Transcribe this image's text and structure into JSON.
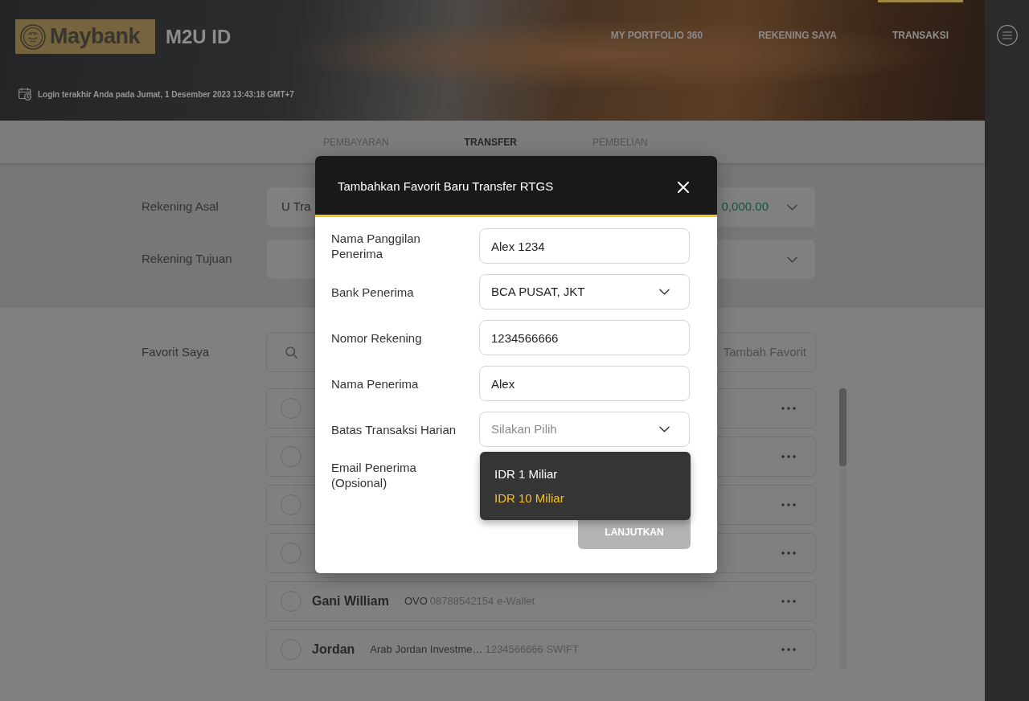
{
  "header": {
    "brand": "Maybank",
    "product": "M2U ID",
    "nav": [
      {
        "label": "MY PORTFOLIO 360",
        "selected": false
      },
      {
        "label": "REKENING SAYA",
        "selected": false
      },
      {
        "label": "TRANSAKSI",
        "selected": true
      }
    ],
    "last_login": "Login terakhir Anda pada Jumat, 1 Desember 2023 13:43:18 GMT+7"
  },
  "tabs": [
    {
      "label": "PEMBAYARAN",
      "selected": false
    },
    {
      "label": "TRANSFER",
      "selected": true
    },
    {
      "label": "PEMBELIAN",
      "selected": false
    }
  ],
  "transfer_form": {
    "rows": [
      {
        "label": "Rekening Asal",
        "value": "U Tra",
        "amount": "0,000.00"
      },
      {
        "label": "Rekening Tujuan"
      }
    ]
  },
  "favorites": {
    "label": "Favorit Saya",
    "add_button": "Tambah Favorit",
    "items": [
      {
        "selected": false
      },
      {
        "selected": false
      },
      {
        "selected": false
      },
      {
        "selected": false
      },
      {
        "selected": false,
        "name": "Gani William",
        "bank": "OVO",
        "detail": "08788542154 e-Wallet"
      },
      {
        "selected": false,
        "name": "Jordan",
        "bank": "Arab Jordan Investme…",
        "detail": "1234566666 SWIFT"
      }
    ]
  },
  "dialog": {
    "title": "Tambahkan Favorit Baru Transfer RTGS",
    "fields": [
      {
        "label": "Nama Panggilan Penerima",
        "kind": "text",
        "value": "Alex 1234"
      },
      {
        "label": "Bank Penerima",
        "kind": "select",
        "value": "BCA PUSAT, JKT"
      },
      {
        "label": "Nomor Rekening",
        "kind": "text",
        "value": "1234566666"
      },
      {
        "label": "Nama Penerima",
        "kind": "text",
        "value": "Alex"
      },
      {
        "label": "Batas Transaksi Harian",
        "kind": "select",
        "placeholder": "Silakan Pilih",
        "options": [
          {
            "label": "IDR 1 Miliar",
            "selected": false
          },
          {
            "label": "IDR 10 Miliar",
            "selected": true
          }
        ]
      },
      {
        "label": "Email Penerima (Opsional)",
        "kind": "covered"
      }
    ],
    "submit": {
      "label": "LANJUTKAN",
      "disabled": true
    }
  }
}
